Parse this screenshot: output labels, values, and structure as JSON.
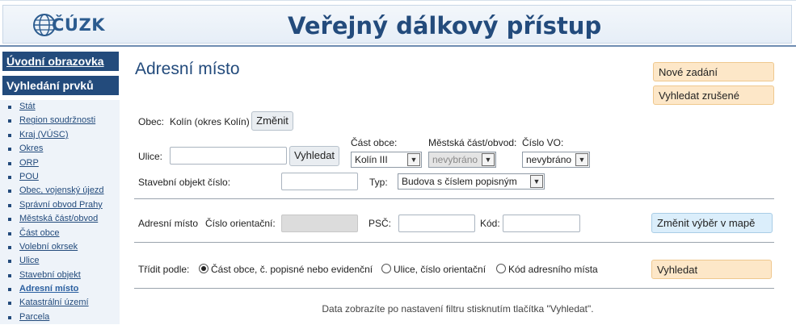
{
  "header": {
    "logo_text": "ČÚZK",
    "title": "Veřejný dálkový přístup"
  },
  "sidebar": {
    "home_label": "Úvodní obrazovka",
    "search_label": "Vyhledání prvků",
    "items": [
      {
        "label": "Stát"
      },
      {
        "label": "Region soudržnosti"
      },
      {
        "label": "Kraj (VÚSC)"
      },
      {
        "label": "Okres"
      },
      {
        "label": "ORP"
      },
      {
        "label": "POU"
      },
      {
        "label": "Obec, vojenský újezd"
      },
      {
        "label": "Správní obvod Prahy"
      },
      {
        "label": "Městská část/obvod"
      },
      {
        "label": "Část obce"
      },
      {
        "label": "Volební okrsek"
      },
      {
        "label": "Ulice"
      },
      {
        "label": "Stavební objekt"
      },
      {
        "label": "Adresní místo"
      },
      {
        "label": "Katastrální území"
      },
      {
        "label": "Parcela"
      }
    ]
  },
  "main": {
    "title": "Adresní místo",
    "new_entry_label": "Nové zadání",
    "search_cancelled_label": "Vyhledat zrušené",
    "obec_label": "Obec:",
    "obec_value": "Kolín (okres Kolín)",
    "change_label": "Změnit",
    "ulice_label": "Ulice:",
    "ulice_value": "",
    "ulice_search_label": "Vyhledat",
    "cast_obce_label": "Část obce:",
    "cast_obce_value": "Kolín III",
    "mestska_cast_label": "Městská část/obvod:",
    "mestska_cast_value": "nevybráno",
    "cislo_vo_label": "Číslo VO:",
    "cislo_vo_value": "nevybráno",
    "stavebni_objekt_label": "Stavební objekt číslo:",
    "typ_label": "Typ:",
    "typ_value": "Budova s číslem popisným",
    "adresni_misto_label": "Adresní místo",
    "cislo_orientacni_label": "Číslo orientační:",
    "psc_label": "PSČ:",
    "kod_label": "Kód:",
    "map_select_label": "Změnit výběr v mapě",
    "sort_label": "Třídit podle:",
    "sort_options": [
      {
        "label": "Část obce, č. popisné nebo evidenční"
      },
      {
        "label": "Ulice, číslo orientační"
      },
      {
        "label": "Kód adresního místa"
      }
    ],
    "search_label": "Vyhledat",
    "note": "Data zobrazíte po nastavení filtru stisknutím tlačítka \"Vyhledat\"."
  }
}
